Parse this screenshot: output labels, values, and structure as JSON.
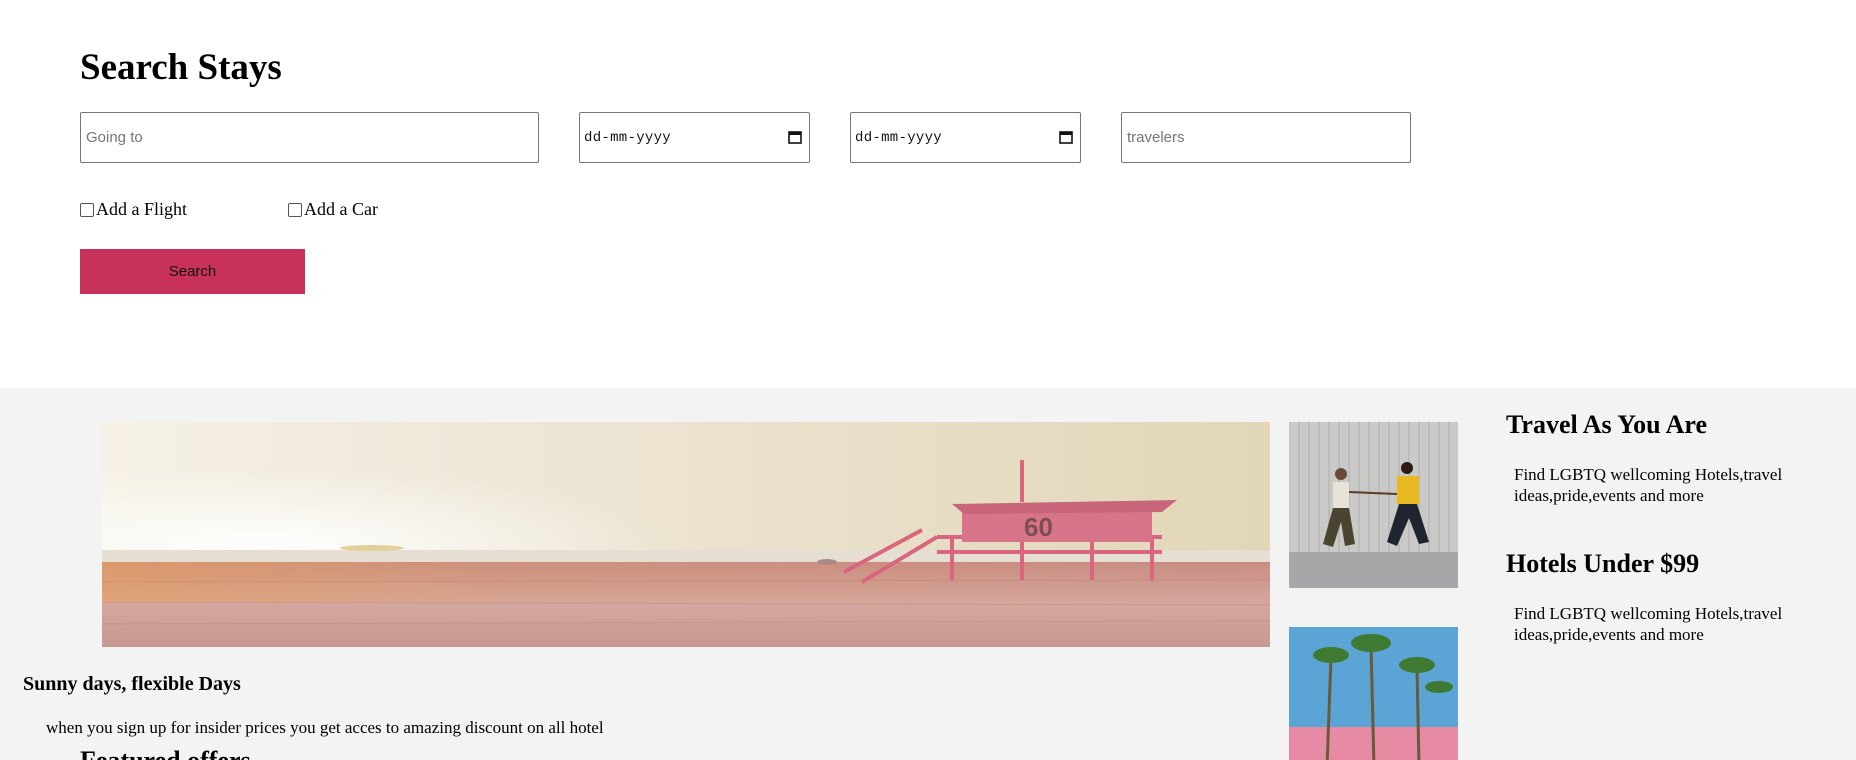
{
  "search": {
    "title": "Search Stays",
    "going_to_placeholder": "Going to",
    "checkin_value": "dd-mm-yyyy",
    "checkout_value": "dd-mm-yyyy",
    "travelers_placeholder": "travelers",
    "add_flight_label": "Add a Flight",
    "add_car_label": "Add a Car",
    "search_button_label": "Search"
  },
  "promo": {
    "title": "Sunny days, flexible Days",
    "text": "when you sign up for insider prices you get acces to amazing discount on all hotel",
    "featured_title": "Featured offers",
    "hero_image": "beach-lifeguard-tower-photo",
    "lifeguard_number": "60"
  },
  "side": {
    "thumb_1": "couple-running-photo",
    "thumb_2": "palm-trees-hotel-photo",
    "card_1_title": "Travel As You Are",
    "card_1_text": "Find LGBTQ wellcoming Hotels,travel ideas,pride,events and more",
    "card_2_title": "Hotels Under $99",
    "card_2_text": "Find LGBTQ wellcoming Hotels,travel ideas,pride,events and more"
  },
  "colors": {
    "accent": "#c8315a",
    "promo_background": "#f3f3f3",
    "page_background": "#ffffff"
  }
}
